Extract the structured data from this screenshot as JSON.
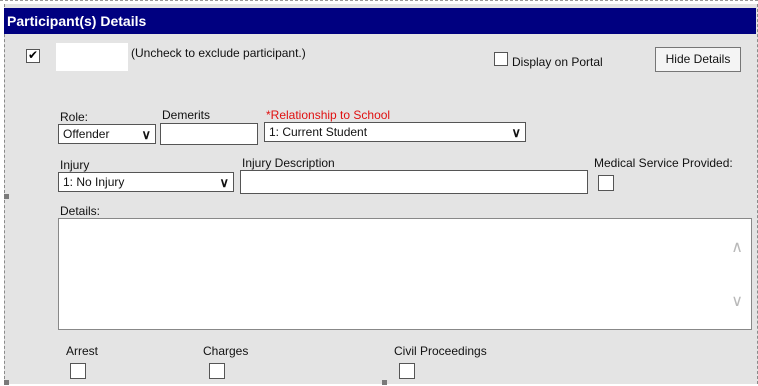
{
  "header": {
    "title": "Participant(s) Details"
  },
  "participant": {
    "include_checked": true,
    "include_label": "(Uncheck to exclude participant.)",
    "display_portal_label": "Display on Portal",
    "hide_details_label": "Hide Details"
  },
  "fields": {
    "role_label": "Role:",
    "role_value": "Offender",
    "demerits_label": "Demerits",
    "demerits_value": "",
    "relationship_label": "*Relationship to School",
    "relationship_value": "1: Current Student",
    "injury_label": "Injury",
    "injury_value": "1: No Injury",
    "injury_desc_label": "Injury Description",
    "injury_desc_value": "",
    "medical_label": "Medical Service Provided:",
    "details_label": "Details:",
    "details_value": ""
  },
  "bottom": {
    "arrest_label": "Arrest",
    "charges_label": "Charges",
    "civil_label": "Civil Proceedings"
  },
  "icons": {
    "chevron": "∨",
    "scroll_up": "∧",
    "scroll_down": "∨"
  }
}
